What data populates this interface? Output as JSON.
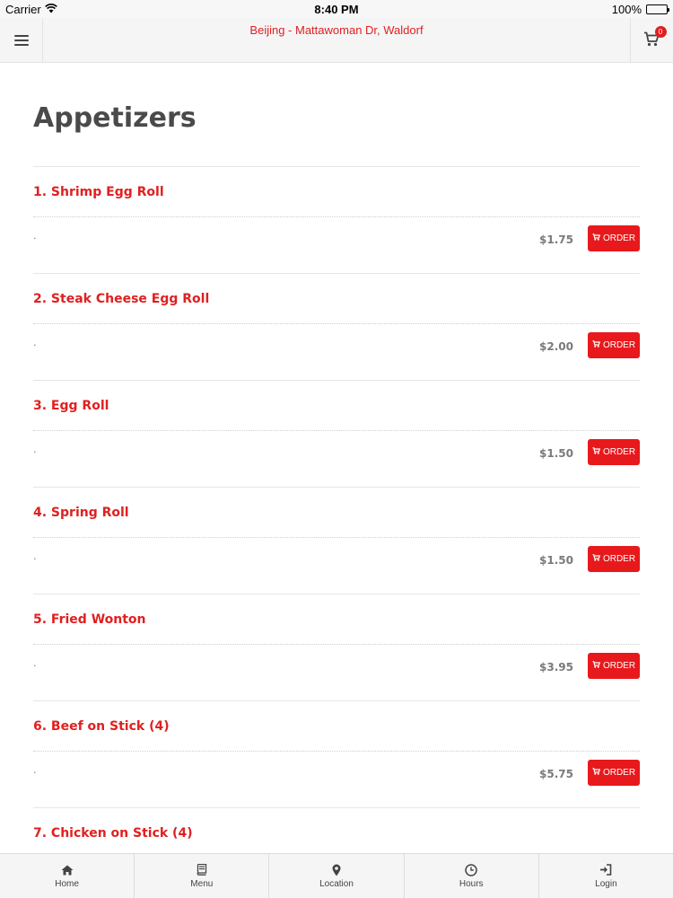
{
  "status_bar": {
    "carrier": "Carrier",
    "time": "8:40 PM",
    "battery": "100%",
    "battery_level": 1.0
  },
  "header": {
    "title": "Beijing - Mattawoman Dr, Waldorf",
    "cart_count": "0"
  },
  "section": {
    "title": "Appetizers"
  },
  "items": [
    {
      "name": "1. Shrimp Egg Roll",
      "desc": ".",
      "price": "$1.75",
      "order_label": "ORDER"
    },
    {
      "name": "2. Steak Cheese Egg Roll",
      "desc": ".",
      "price": "$2.00",
      "order_label": "ORDER"
    },
    {
      "name": "3. Egg Roll",
      "desc": ".",
      "price": "$1.50",
      "order_label": "ORDER"
    },
    {
      "name": "4. Spring Roll",
      "desc": ".",
      "price": "$1.50",
      "order_label": "ORDER"
    },
    {
      "name": "5. Fried Wonton",
      "desc": ".",
      "price": "$3.95",
      "order_label": "ORDER"
    },
    {
      "name": "6. Beef on Stick (4)",
      "desc": ".",
      "price": "$5.75",
      "order_label": "ORDER"
    },
    {
      "name": "7. Chicken on Stick (4)",
      "desc": "",
      "price": "",
      "order_label": ""
    }
  ],
  "bottom_nav": [
    {
      "label": "Home",
      "icon": "home-icon"
    },
    {
      "label": "Menu",
      "icon": "book-icon"
    },
    {
      "label": "Location",
      "icon": "map-pin-icon"
    },
    {
      "label": "Hours",
      "icon": "clock-icon"
    },
    {
      "label": "Login",
      "icon": "login-icon"
    }
  ],
  "colors": {
    "accent": "#e02020",
    "order_button": "#e8191c",
    "header_bg": "#f5f5f5"
  }
}
